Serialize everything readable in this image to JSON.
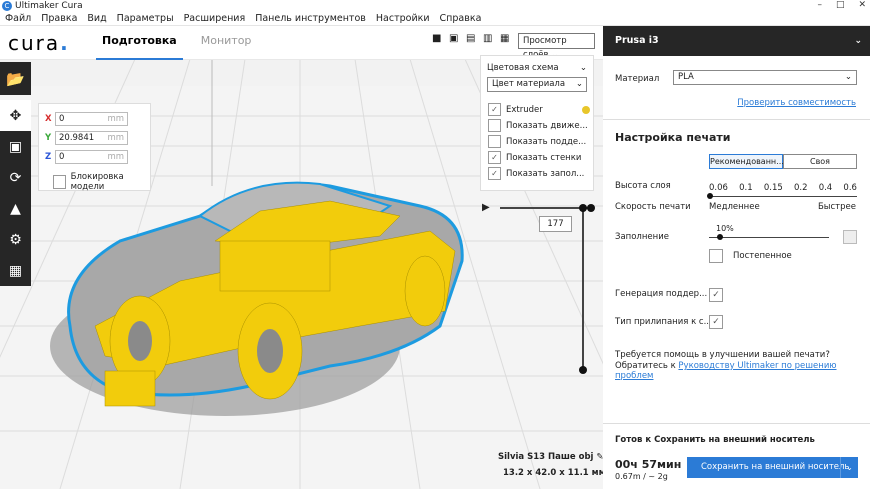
{
  "window": {
    "title": "Ultimaker Cura",
    "icon": "cura-app-icon"
  },
  "menu": [
    "Файл",
    "Правка",
    "Вид",
    "Параметры",
    "Расширения",
    "Панель инструментов",
    "Настройки",
    "Справка"
  ],
  "header": {
    "logo_text": "cura",
    "logo_dot": ".",
    "tabs": [
      {
        "label": "Подготовка",
        "active": true
      },
      {
        "label": "Монитор",
        "active": false
      }
    ],
    "view_icons": [
      "3d-view-icon",
      "front-view-icon",
      "top-view-icon",
      "left-view-icon",
      "right-view-icon"
    ],
    "view_mode": "Просмотр слоёв"
  },
  "toolbar": {
    "items": [
      "open-folder-icon",
      "move-icon",
      "scale-icon",
      "rotate-icon",
      "mirror-icon",
      "per-model-settings-icon",
      "support-blocker-icon"
    ],
    "active": "move-icon"
  },
  "move_panel": {
    "x": {
      "label": "X",
      "value": "0",
      "unit": "mm",
      "color": "#d62d2d"
    },
    "y": {
      "label": "Y",
      "value": "20.9841",
      "unit": "mm",
      "color": "#3aa83a"
    },
    "z": {
      "label": "Z",
      "value": "0",
      "unit": "mm",
      "color": "#2b55d6"
    },
    "lock_label": "Блокировка модели"
  },
  "layer_panel": {
    "color_scheme_label": "Цветовая схема",
    "color_scheme_value": "Цвет материала",
    "options": [
      {
        "label": "Extruder",
        "checked": true,
        "swatch": "#e8c62a"
      },
      {
        "label": "Показать движе...",
        "checked": false
      },
      {
        "label": "Показать подде...",
        "checked": false
      },
      {
        "label": "Показать стенки",
        "checked": true
      },
      {
        "label": "Показать запол...",
        "checked": true
      }
    ],
    "current_layer": "177"
  },
  "model": {
    "name": "Silvia S13 Паше obj",
    "dims": "13.2 x 42.0 x 11.1 мм"
  },
  "sidebar": {
    "printer": "Prusa i3",
    "material_label": "Материал",
    "material_value": "PLA",
    "compat_link": "Проверить совместимость",
    "settings_title": "Настройка печати",
    "mode_recommended": "Рекомендованн...",
    "mode_custom": "Своя",
    "layer_height_label": "Высота слоя",
    "layer_heights": [
      "0.06",
      "0.1",
      "0.15",
      "0.2",
      "0.4",
      "0.6"
    ],
    "layer_height_selected": "0.06",
    "speed_label": "Скорость печати",
    "speed_slow": "Медленнее",
    "speed_fast": "Быстрее",
    "infill_label": "Заполнение",
    "infill_value": "10%",
    "infill_fraction": 0.1,
    "gradual_label": "Постепенное",
    "gradual_checked": false,
    "support_label": "Генерация поддер...",
    "support_checked": true,
    "adhesion_label": "Тип прилипания к с...",
    "adhesion_checked": true,
    "help_line1": "Требуется помощь в улучшении вашей печати?",
    "help_line2_prefix": "Обратитесь к ",
    "help_link": "Руководству Ultimaker по решению проблем",
    "ready_text": "Готов к Сохранить на внешний носитель",
    "print_time": "00ч 57мин",
    "material_usage": "0.67m / ~ 2g",
    "save_button": "Сохранить на внешний носитель",
    "accent": "#2b7bd6"
  }
}
